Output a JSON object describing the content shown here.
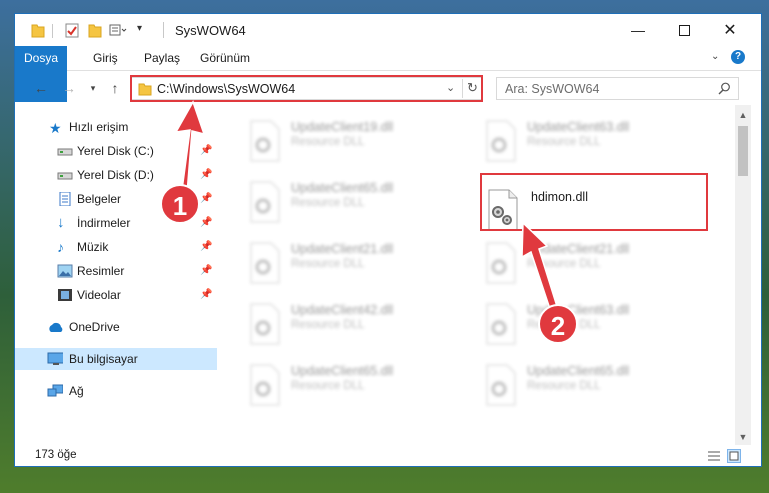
{
  "window": {
    "title": "SysWOW64"
  },
  "ribbon": {
    "tabs": [
      "Dosya",
      "Giriş",
      "Paylaş",
      "Görünüm"
    ]
  },
  "address": {
    "path": "C:\\Windows\\SysWOW64"
  },
  "search": {
    "placeholder": "Ara: SysWOW64"
  },
  "sidebar": {
    "items": [
      {
        "label": "Hızlı erişim",
        "icon": "star-icon",
        "pinned": false
      },
      {
        "label": "Yerel Disk (C:)",
        "icon": "drive-icon",
        "pinned": true
      },
      {
        "label": "Yerel Disk (D:)",
        "icon": "drive-icon",
        "pinned": true
      },
      {
        "label": "Belgeler",
        "icon": "documents-icon",
        "pinned": true
      },
      {
        "label": "İndirmeler",
        "icon": "download-icon",
        "pinned": true
      },
      {
        "label": "Müzik",
        "icon": "music-icon",
        "pinned": true
      },
      {
        "label": "Resimler",
        "icon": "pictures-icon",
        "pinned": true
      },
      {
        "label": "Videolar",
        "icon": "video-icon",
        "pinned": true
      },
      {
        "label": "OneDrive",
        "icon": "cloud-icon",
        "pinned": false
      },
      {
        "label": "Bu bilgisayar",
        "icon": "computer-icon",
        "pinned": false,
        "selected": true
      },
      {
        "label": "Ağ",
        "icon": "network-icon",
        "pinned": false
      }
    ]
  },
  "files": [
    {
      "name": "UpdateClient19.dll",
      "desc": "Resource DLL",
      "blurred": true
    },
    {
      "name": "UpdateClient63.dll",
      "desc": "Resource DLL",
      "blurred": true
    },
    {
      "name": "UpdateClient65.dll",
      "desc": "Resource DLL",
      "blurred": true
    },
    {
      "name": "hdimon.dll",
      "desc": "",
      "blurred": false
    },
    {
      "name": "UpdateClient21.dll",
      "desc": "Resource DLL",
      "blurred": true
    },
    {
      "name": "UpdateClient21.dll",
      "desc": "Resource DLL",
      "blurred": true
    },
    {
      "name": "UpdateClient42.dll",
      "desc": "Resource DLL",
      "blurred": true
    },
    {
      "name": "UpdateClient63.dll",
      "desc": "Resource DLL",
      "blurred": true
    },
    {
      "name": "UpdateClient65.dll",
      "desc": "Resource DLL",
      "blurred": true
    },
    {
      "name": "UpdateClient65.dll",
      "desc": "Resource DLL",
      "blurred": true
    }
  ],
  "status": {
    "count": "173 öğe"
  },
  "annotations": {
    "callout1": "1",
    "callout2": "2",
    "color": "#e0393e"
  },
  "colors": {
    "accent": "#1979ca",
    "selected": "#cce8ff"
  }
}
